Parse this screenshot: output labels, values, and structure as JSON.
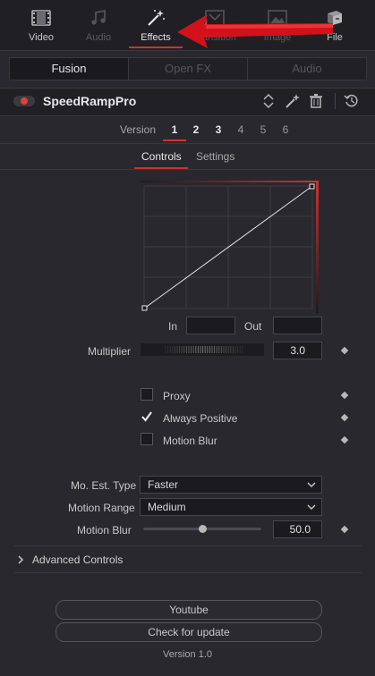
{
  "top_tabs": [
    {
      "label": "Video",
      "icon": "film-icon",
      "state": "normal"
    },
    {
      "label": "Audio",
      "icon": "music-note-icon",
      "state": "dim"
    },
    {
      "label": "Effects",
      "icon": "magic-wand-icon",
      "state": "active"
    },
    {
      "label": "Transition",
      "icon": "transition-icon",
      "state": "dim"
    },
    {
      "label": "Image",
      "icon": "image-icon",
      "state": "dim"
    },
    {
      "label": "File",
      "icon": "file-cabinet-icon",
      "state": "normal"
    }
  ],
  "segments": [
    "Fusion",
    "Open FX",
    "Audio"
  ],
  "plugin": {
    "title": "SpeedRampPro"
  },
  "version_row": {
    "label": "Version",
    "numbers": [
      "1",
      "2",
      "3",
      "4",
      "5",
      "6"
    ]
  },
  "sub_tabs": [
    "Controls",
    "Settings"
  ],
  "curve": {
    "in_label": "In",
    "out_label": "Out",
    "in_value": "",
    "out_value": ""
  },
  "multiplier": {
    "label": "Multiplier",
    "value": "3.0"
  },
  "checkboxes": [
    {
      "label": "Proxy",
      "checked": false
    },
    {
      "label": "Always Positive",
      "checked": true
    },
    {
      "label": "Motion Blur",
      "checked": false
    }
  ],
  "mo_est": {
    "label": "Mo. Est. Type",
    "value": "Faster"
  },
  "motion_range": {
    "label": "Motion Range",
    "value": "Medium"
  },
  "motion_blur": {
    "label": "Motion Blur",
    "value": "50.0",
    "slider_fraction": 0.5
  },
  "advanced": {
    "label": "Advanced Controls"
  },
  "buttons": {
    "youtube": "Youtube",
    "update": "Check for update"
  },
  "footer": {
    "version": "Version 1.0"
  },
  "colors": {
    "accent": "#d0312d",
    "arrow": "#e0101a"
  }
}
